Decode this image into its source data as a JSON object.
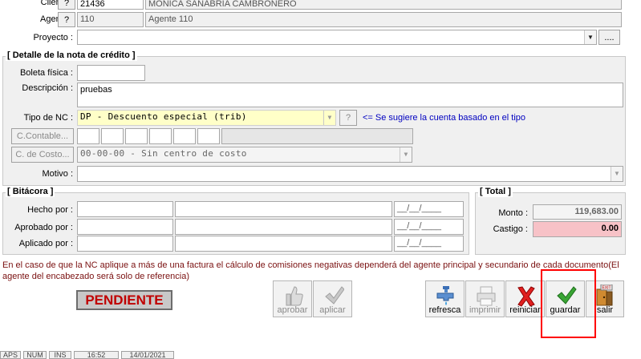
{
  "cliente": {
    "label": "Cliente :",
    "code": "21436",
    "name": "MONICA SANABRIA CAMBRONERO"
  },
  "agente": {
    "label": "Agente :",
    "code": "110",
    "name": "Agente 110"
  },
  "proyecto": {
    "label": "Proyecto :",
    "value": "",
    "browse_label": "...."
  },
  "lookup_label": "?",
  "detalle": {
    "title": "[ Detalle de la nota de crédito ]",
    "boleta": {
      "label": "Boleta física :",
      "value": ""
    },
    "descripcion": {
      "label": "Descripción :",
      "value": "pruebas"
    },
    "tipo_nc": {
      "label": "Tipo de NC :",
      "value": "DP - Descuento especial (trib)",
      "hint": "<= Se sugiere la cuenta basado en el tipo"
    },
    "c_contable": {
      "label": "C.Contable..."
    },
    "c_costo": {
      "label": "C. de Costo...",
      "value": "00-00-00 - Sin centro de costo"
    },
    "motivo": {
      "label": "Motivo :",
      "value": ""
    }
  },
  "bitacora": {
    "title": "[ Bitácora ]",
    "rows": [
      {
        "label": "Hecho por :",
        "date": "__/__/____"
      },
      {
        "label": "Aprobado por :",
        "date": "__/__/____"
      },
      {
        "label": "Aplicado por :",
        "date": "__/__/____"
      }
    ]
  },
  "total": {
    "title": "[ Total ]",
    "monto": {
      "label": "Monto :",
      "value": "119,683.00"
    },
    "castigo": {
      "label": "Castigo :",
      "value": "0.00"
    }
  },
  "note": "En el caso de que la NC aplique a más de una factura el cálculo de comisiones negativas dependerá del agente principal y secundario de cada documento(El agente del encabezado será solo de referencia)",
  "status_badge": "PENDIENTE",
  "toolbar": {
    "aprobar": "aprobar",
    "aplicar": "aplicar",
    "refresca": "refresca",
    "imprimir": "imprimir",
    "reiniciar": "reiniciar",
    "guardar": "guardar",
    "salir": "salir",
    "exit_sign": "EXIT"
  },
  "statusbar": {
    "caps": "APS",
    "num": "NUM",
    "ins": "INS",
    "time": "16:52",
    "date": "14/01/2021"
  },
  "colors": {
    "highlight_yellow": "#ffffc8",
    "castigo_pink": "#f7c2c7",
    "badge_red": "#c00000",
    "focus_red": "#ff0000",
    "hint_blue": "#0000c0"
  },
  "icons": {
    "aprobar": "thumbs-up-icon",
    "aplicar": "checkmark-icon",
    "refresca": "faucet-icon",
    "imprimir": "printer-icon",
    "reiniciar": "red-x-icon",
    "guardar": "green-checkmark-icon",
    "salir": "exit-door-icon"
  }
}
